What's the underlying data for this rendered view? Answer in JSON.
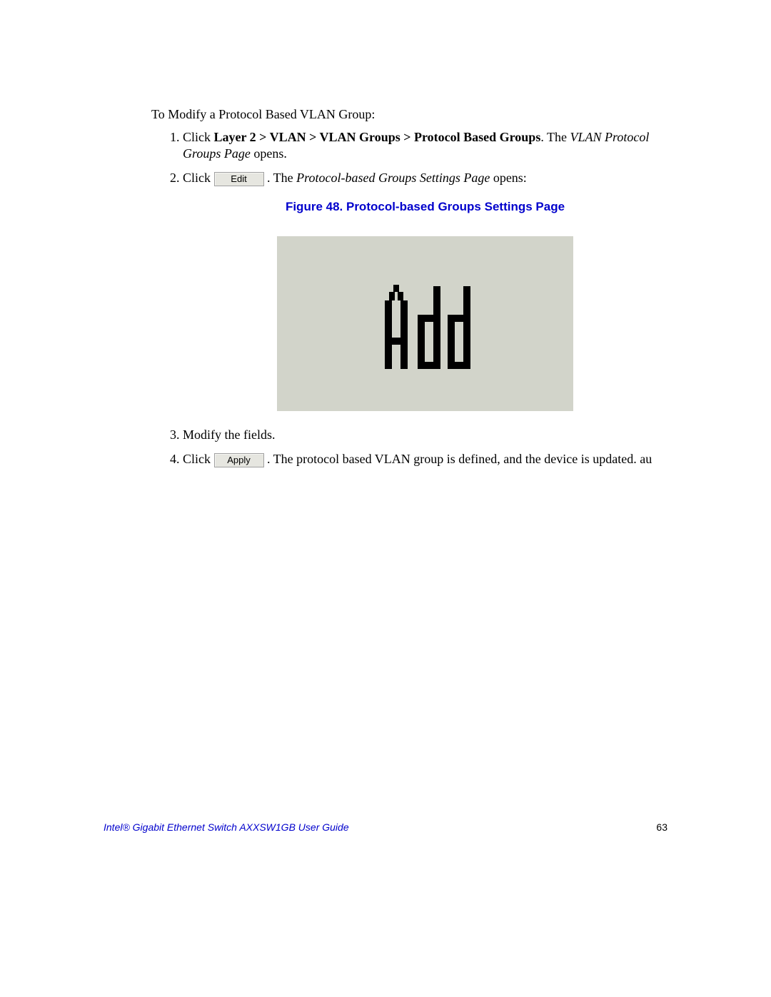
{
  "intro": "To Modify a Protocol Based VLAN Group:",
  "steps": {
    "s1": {
      "click": "Click ",
      "path_bold": "Layer 2 > VLAN > VLAN Groups > Protocol Based Groups",
      "after_path": ". The ",
      "italic": "VLAN Protocol Groups Page",
      "end": " opens."
    },
    "s2": {
      "click": "Click ",
      "btn": "Edit",
      "after_btn": " . The ",
      "italic": "Protocol-based Groups Settings Page",
      "end": " opens:"
    },
    "s3": {
      "text": "Modify the fields."
    },
    "s4": {
      "click": "Click ",
      "btn": "Apply",
      "after_btn": ". The protocol based VLAN group is defined, and the device is updated. au"
    }
  },
  "figure": {
    "caption": "Figure 48. Protocol-based Groups Settings Page",
    "glyph_label": "Add"
  },
  "footer": {
    "title": "Intel® Gigabit Ethernet Switch AXXSW1GB User Guide",
    "page": "63"
  }
}
